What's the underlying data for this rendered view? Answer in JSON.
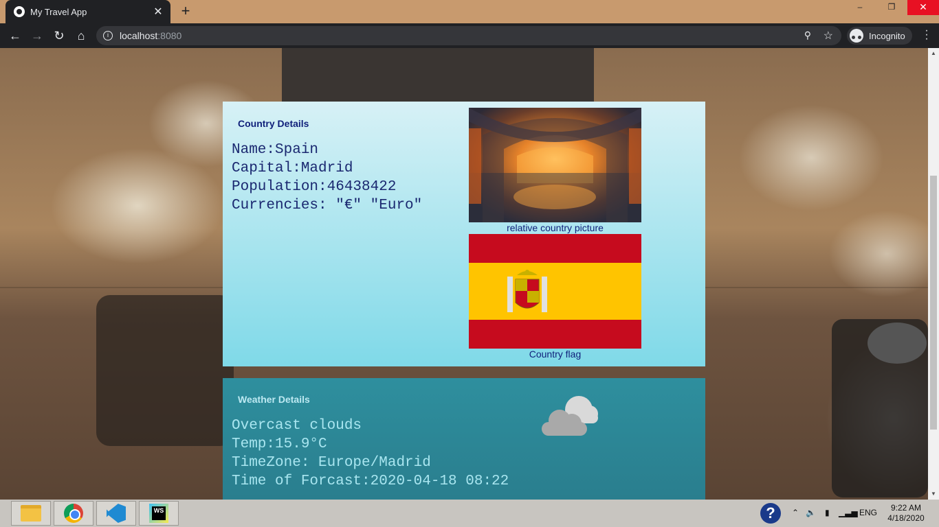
{
  "browser": {
    "tab_title": "My Travel App",
    "tab_close": "✕",
    "new_tab": "+",
    "url_host": "localhost",
    "url_port": ":8080",
    "profile_label": "Incognito",
    "window_controls": {
      "minimize": "–",
      "maximize": "❐",
      "close": "✕"
    }
  },
  "country": {
    "heading": "Country Details",
    "name": "Name:Spain",
    "capital": "Capital:Madrid",
    "population": "Population:46438422",
    "currencies": "Currencies: \"€\" \"Euro\"",
    "picture_caption": "relative country picture",
    "flag_caption": "Country flag",
    "flag_colors": {
      "red": "#c60b1e",
      "yellow": "#ffc400"
    }
  },
  "weather": {
    "heading": "Weather Details",
    "description": "Overcast clouds",
    "temp": "Temp:15.9°C",
    "timezone": "TimeZone: Europe/Madrid",
    "forecast_time": "Time of Forcast:2020-04-18 08:22",
    "icon": "overcast-clouds-icon"
  },
  "taskbar": {
    "apps": [
      "file-explorer-icon",
      "chrome-icon",
      "vscode-icon",
      "webstorm-icon"
    ],
    "webstorm_label": "WS",
    "language": "ENG",
    "time": "9:22 AM",
    "date": "4/18/2020"
  },
  "colors": {
    "country_card_top": "#d7f1f6",
    "country_card_bottom": "#7fd9e8",
    "weather_card": "#2e8f9e",
    "heading_navy": "#0f1f7a"
  }
}
